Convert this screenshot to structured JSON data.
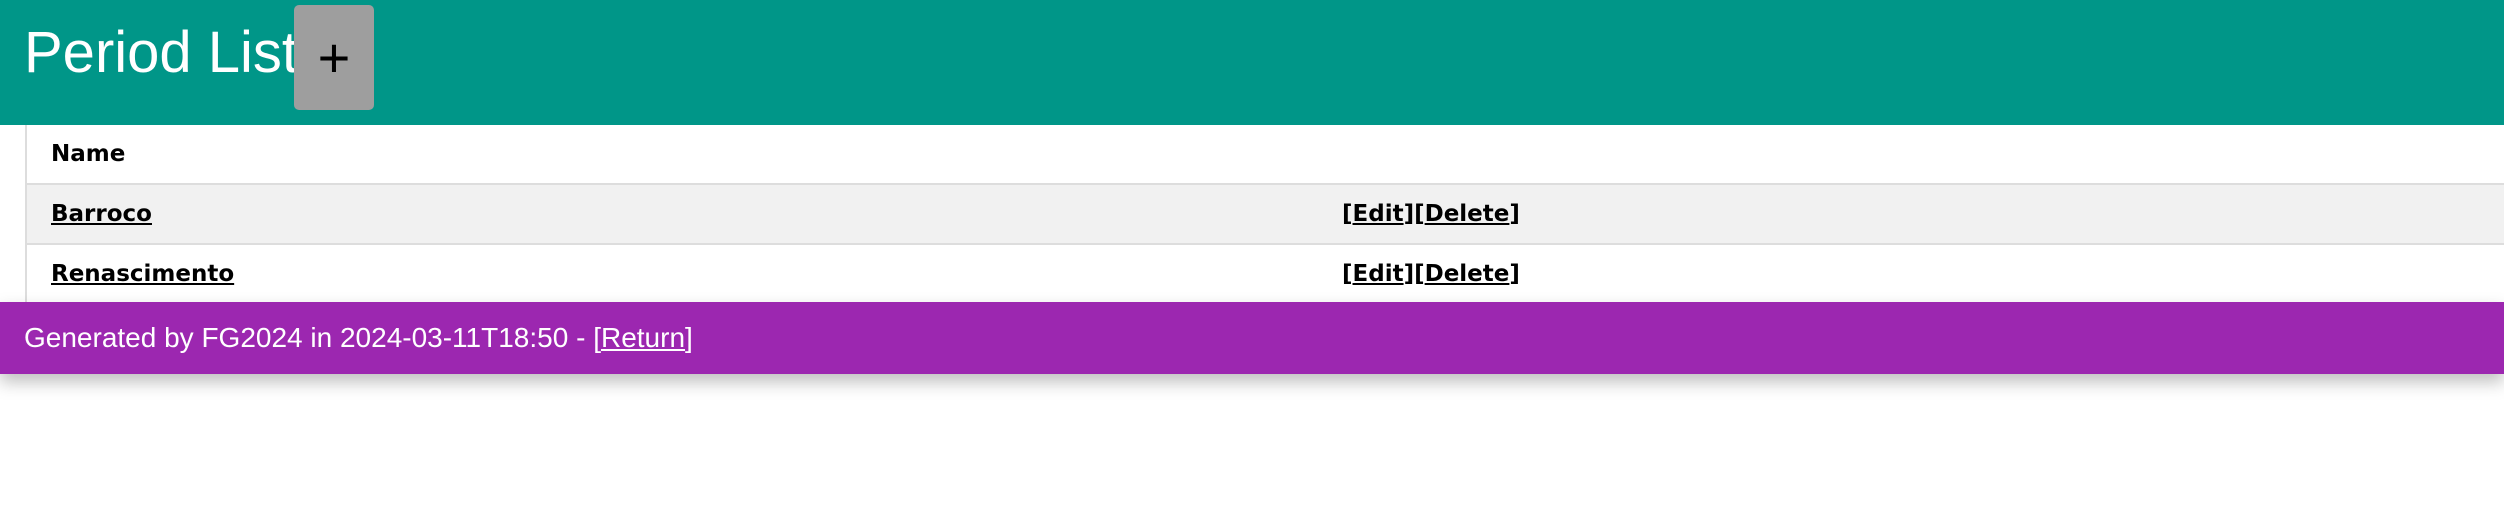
{
  "header": {
    "title": "Period List",
    "add_label": "+"
  },
  "table": {
    "columns": [
      "Name",
      ""
    ],
    "rows": [
      {
        "name": "Barroco",
        "edit": "Edit",
        "delete": "Delete"
      },
      {
        "name": "Renascimento",
        "edit": "Edit",
        "delete": "Delete"
      }
    ]
  },
  "footer": {
    "text": "Generated by FG2024 in 2024-03-11T18:50 - ",
    "return_label": "Return"
  },
  "colors": {
    "header": "#009688",
    "footer": "#9c27b0",
    "button": "#9e9e9e"
  }
}
